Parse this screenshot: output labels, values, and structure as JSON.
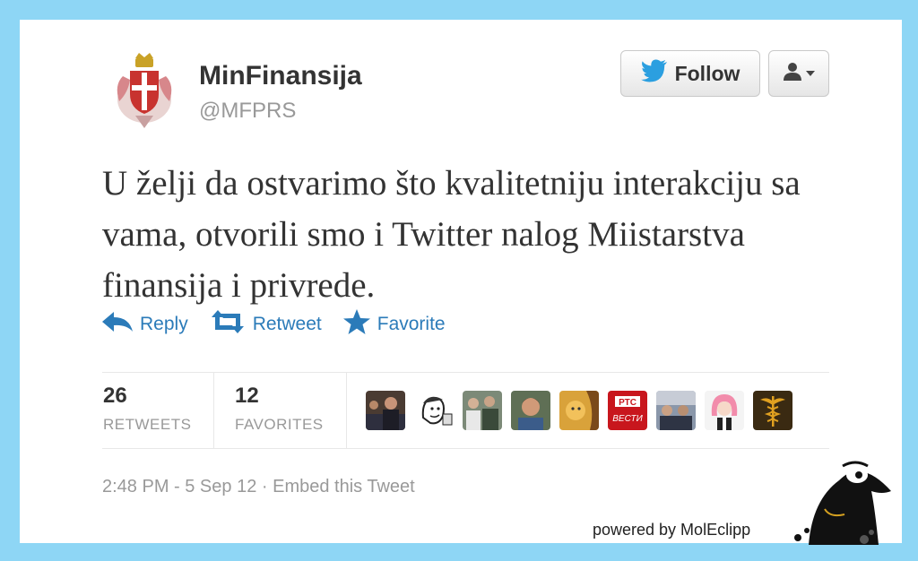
{
  "tweet": {
    "display_name": "MinFinansija",
    "handle": "@MFPRS",
    "text": "U želji da ostvarimo što kvalitetniju interakciju sa vama, otvorili smo i Twitter nalog Miistarstva finansija i privrede.",
    "follow_label": "Follow",
    "actions": {
      "reply": "Reply",
      "retweet": "Retweet",
      "favorite": "Favorite"
    },
    "stats": {
      "retweets_count": "26",
      "retweets_label": "RETWEETS",
      "favorites_count": "12",
      "favorites_label": "FAVORITES"
    },
    "timestamp": "2:48 PM - 5 Sep 12",
    "separator": "·",
    "embed_label": "Embed this Tweet",
    "favoriter_avatars": [
      {
        "icon": "avatar-office-icon",
        "color": "#4a3b32"
      },
      {
        "icon": "avatar-cartoon-icon",
        "color": "#d8d8d8"
      },
      {
        "icon": "avatar-crowd-icon",
        "color": "#7c8a78"
      },
      {
        "icon": "avatar-man-icon",
        "color": "#9a7a5a"
      },
      {
        "icon": "avatar-yellow-icon",
        "color": "#d9a23a"
      },
      {
        "icon": "avatar-rts-vesti-icon",
        "color": "#c8161d",
        "text_top": "РТС",
        "text_bottom": "ВЕСТИ"
      },
      {
        "icon": "avatar-group-icon",
        "color": "#56647a"
      },
      {
        "icon": "avatar-pink-hair-icon",
        "color": "#f2a0b8"
      },
      {
        "icon": "avatar-caduceus-icon",
        "color": "#3a2a12"
      }
    ]
  },
  "footer": {
    "powered_by": "powered by MolEclipp"
  },
  "colors": {
    "background": "#8ed6f5",
    "link": "#2b7bb9",
    "muted": "#999999",
    "text": "#333333"
  }
}
